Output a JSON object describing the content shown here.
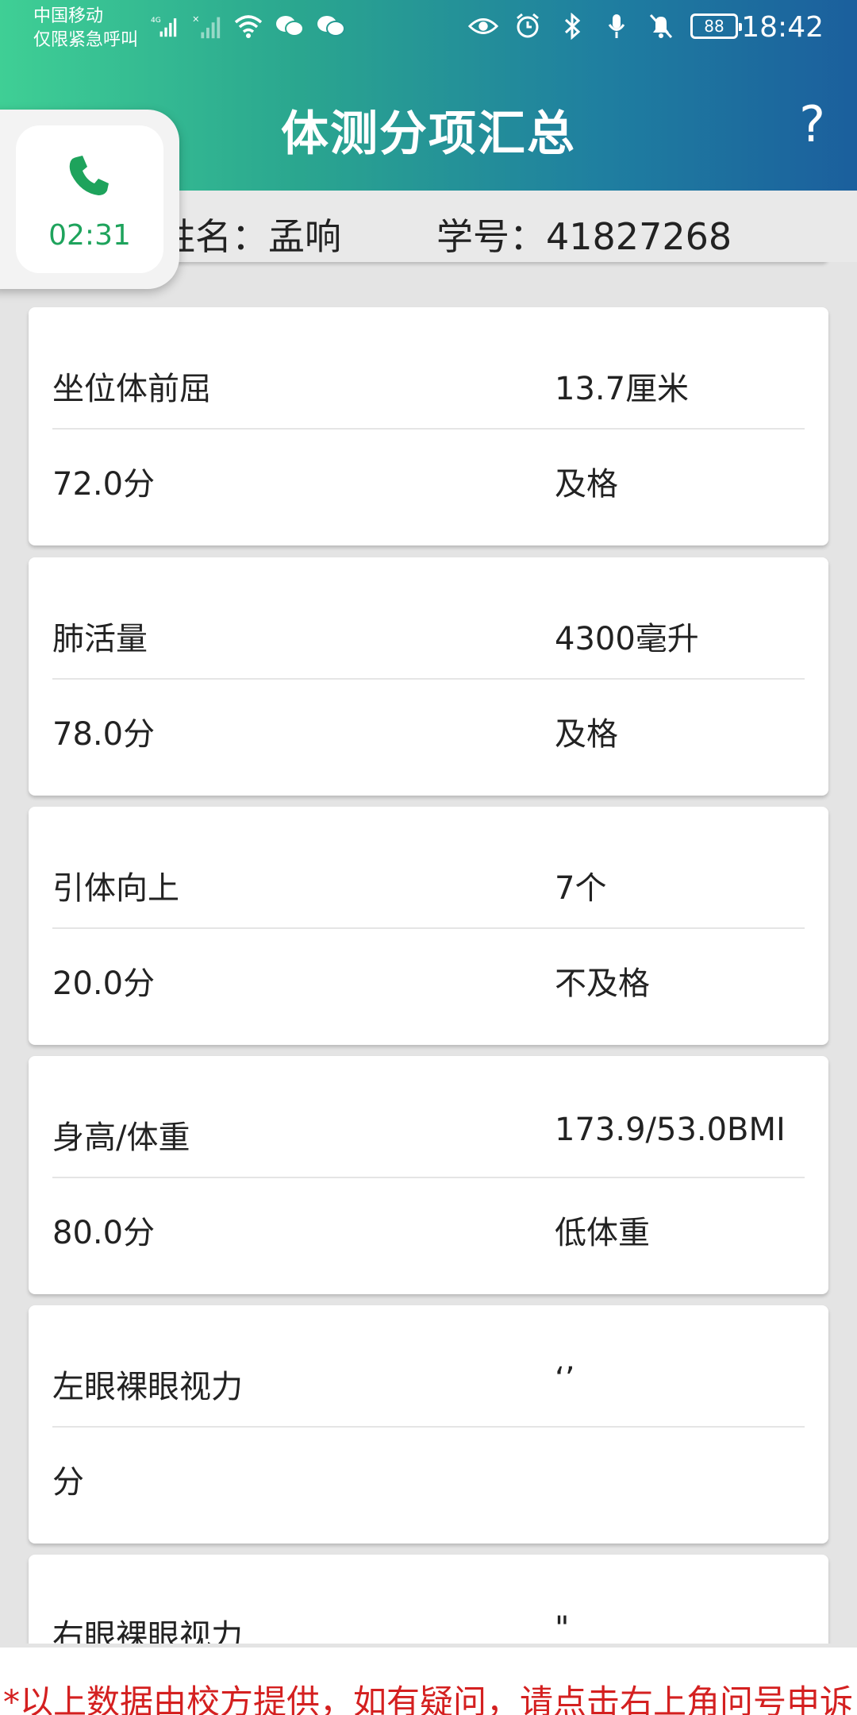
{
  "status_bar": {
    "carrier_line1": "中国移动",
    "carrier_line2": "仅限紧急呼叫",
    "network": "4G",
    "battery": "88",
    "time": "18:42",
    "left_icons": [
      "signal-icon",
      "no-signal-icon",
      "wifi-icon",
      "wechat-icon",
      "wechat-icon"
    ],
    "right_icons": [
      "eye-icon",
      "alarm-icon",
      "bluetooth-icon",
      "mic-icon",
      "mute-bell-icon"
    ]
  },
  "header": {
    "title": "体测分项汇总",
    "help_label": "?"
  },
  "info": {
    "name_text": "姓名：孟响",
    "student_id_text": "学号：41827268"
  },
  "call_bubble": {
    "duration": "02:31"
  },
  "items": [
    {
      "label": "坐位体前屈",
      "value": "13.7厘米",
      "score": "72.0分",
      "grade": "及格"
    },
    {
      "label": "肺活量",
      "value": "4300毫升",
      "score": "78.0分",
      "grade": "及格"
    },
    {
      "label": "引体向上",
      "value": "7个",
      "score": "20.0分",
      "grade": "不及格"
    },
    {
      "label": "身高/体重",
      "value": "173.9/53.0BMI",
      "score": "80.0分",
      "grade": "低体重"
    },
    {
      "label": "左眼裸眼视力",
      "value": "‘’",
      "score": "分",
      "grade": ""
    },
    {
      "label": "右眼裸眼视力",
      "value": "\"",
      "score": "",
      "grade": ""
    }
  ],
  "footer": {
    "notice": "*以上数据由校方提供，如有疑问，请点击右上角问号申诉"
  },
  "colors": {
    "header_gradient_start": "#3fcf95",
    "header_gradient_end": "#1b5f9d",
    "notice_red": "#d42020",
    "call_green": "#1ea35c"
  }
}
